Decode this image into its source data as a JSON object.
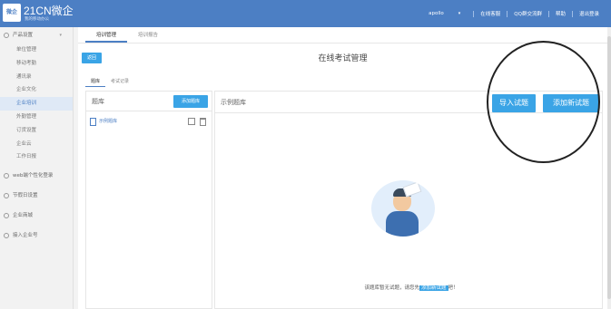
{
  "header": {
    "logo_text": "微企",
    "brand": "21CN微企",
    "brand_sub": "我的移动办公",
    "nav": [
      "apollo",
      "在线客服",
      "QQ群交流群",
      "帮助",
      "退出登录"
    ]
  },
  "sidebar": {
    "groups": [
      {
        "label": "产品设置",
        "items": [
          "单位管理",
          "移动考勤",
          "通讯录",
          "企业文化",
          "企业培训",
          "外勤管理",
          "订货设置",
          "企业云",
          "工作日报"
        ]
      },
      {
        "label": "web端个性化登录"
      },
      {
        "label": "节假日设置"
      },
      {
        "label": "企业商城"
      },
      {
        "label": "接入企业号"
      }
    ],
    "active_item": "企业培训"
  },
  "main": {
    "tabs": [
      "培训管理",
      "培训报告"
    ],
    "back_label": "返回",
    "title": "在线考试管理",
    "sub_tabs": [
      "题库",
      "考试记录"
    ]
  },
  "bank": {
    "title": "题库",
    "add_label": "添加题库",
    "items": [
      {
        "name": "示例题库"
      }
    ]
  },
  "sample": {
    "title": "示例题库",
    "import_label": "导入试题",
    "add_label": "添加新试题",
    "empty_prefix": "该题库暂无试题，请您先",
    "empty_link": "添加新试题",
    "empty_suffix": "吧！"
  },
  "colors": {
    "header": "#4c7fc4",
    "button": "#3aa4e6"
  }
}
